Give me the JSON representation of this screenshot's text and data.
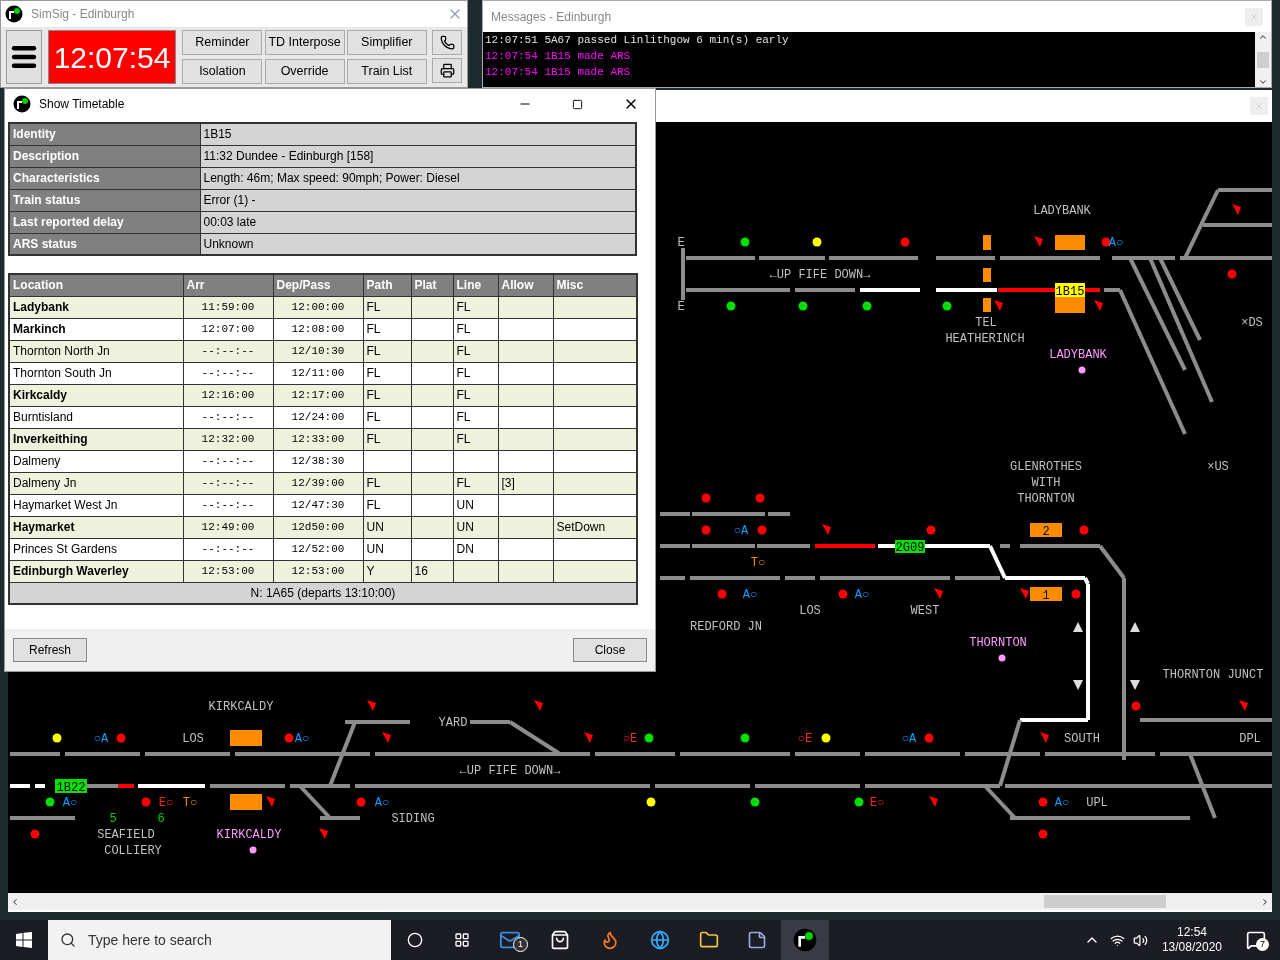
{
  "main_window": {
    "title": "SimSig - Edinburgh",
    "clock": "12:07:54",
    "buttons": [
      "Reminder",
      "TD Interpose",
      "Simplifier",
      "Isolation",
      "Override",
      "Train List"
    ]
  },
  "messages_window": {
    "title": "Messages - Edinburgh",
    "lines": [
      {
        "text": "12:07:51 5A67 passed Linlithgow 6 min(s) early",
        "kind": "event"
      },
      {
        "text": "12:07:54 1B15 made ARS",
        "kind": "ars"
      },
      {
        "text": "12:07:54 1B15 made ARS",
        "kind": "ars"
      }
    ]
  },
  "timetable_window": {
    "title": "Show Timetable",
    "details": [
      {
        "label": "Identity",
        "value": "1B15"
      },
      {
        "label": "Description",
        "value": "11:32 Dundee - Edinburgh [158]"
      },
      {
        "label": "Characteristics",
        "value": "Length: 46m; Max speed: 90mph; Power: Diesel"
      },
      {
        "label": "Train status",
        "value": "Error (1) -"
      },
      {
        "label": "Last reported delay",
        "value": "00:03 late"
      },
      {
        "label": "ARS status",
        "value": "Unknown"
      }
    ],
    "columns": [
      "Location",
      "Arr",
      "Dep/Pass",
      "Path",
      "Plat",
      "Line",
      "Allow",
      "Misc"
    ],
    "rows": [
      {
        "kind": "stop",
        "location": "Ladybank",
        "arr": "11:59:00",
        "dep": "12:00:00",
        "path": "FL",
        "line": "FL"
      },
      {
        "kind": "stop",
        "location": "Markinch",
        "arr": "12:07:00",
        "dep": "12:08:00",
        "path": "FL",
        "line": "FL"
      },
      {
        "kind": "pass",
        "location": "Thornton North Jn",
        "arr": "--:--:--",
        "dep": "12/10:30",
        "path": "FL",
        "line": "FL"
      },
      {
        "kind": "pass",
        "location": "Thornton South Jn",
        "arr": "--:--:--",
        "dep": "12/11:00",
        "path": "FL",
        "line": "FL"
      },
      {
        "kind": "stop",
        "location": "Kirkcaldy",
        "arr": "12:16:00",
        "dep": "12:17:00",
        "path": "FL",
        "line": "FL"
      },
      {
        "kind": "pass",
        "location": "Burntisland",
        "arr": "--:--:--",
        "dep": "12/24:00",
        "path": "FL",
        "line": "FL"
      },
      {
        "kind": "stop",
        "location": "Inverkeithing",
        "arr": "12:32:00",
        "dep": "12:33:00",
        "path": "FL",
        "line": "FL"
      },
      {
        "kind": "pass",
        "location": "Dalmeny",
        "arr": "--:--:--",
        "dep": "12/38:30"
      },
      {
        "kind": "pass",
        "location": "Dalmeny Jn",
        "arr": "--:--:--",
        "dep": "12/39:00",
        "path": "FL",
        "line": "FL",
        "allow": "[3]"
      },
      {
        "kind": "pass",
        "location": "Haymarket West Jn",
        "arr": "--:--:--",
        "dep": "12/47:30",
        "path": "FL",
        "line": "UN"
      },
      {
        "kind": "stop",
        "location": "Haymarket",
        "arr": "12:49:00",
        "dep": "12d50:00",
        "path": "UN",
        "line": "UN",
        "misc": "SetDown"
      },
      {
        "kind": "pass",
        "location": "Princes St Gardens",
        "arr": "--:--:--",
        "dep": "12/52:00",
        "path": "UN",
        "line": "DN"
      },
      {
        "kind": "stop",
        "location": "Edinburgh Waverley",
        "arr": "12:53:00",
        "dep": "12:53:00",
        "path": "Y",
        "plat": "16"
      }
    ],
    "footer": "N: 1A65 (departs 13:10:00)",
    "buttons": [
      "Refresh",
      "Close"
    ]
  },
  "diagram": {
    "labels": [
      {
        "text": "E",
        "kind": "area"
      },
      {
        "text": "E",
        "kind": "area"
      },
      {
        "text": "LADYBANK",
        "kind": "area"
      },
      {
        "text": "←UP FIFE DOWN→",
        "kind": "area"
      },
      {
        "text": "TEL",
        "kind": "area"
      },
      {
        "text": "HEATHERINCH",
        "kind": "area"
      },
      {
        "text": "LADYBANK",
        "kind": "station"
      },
      {
        "text": "×DS",
        "kind": "area"
      },
      {
        "text": "×US",
        "kind": "area"
      },
      {
        "text": "GLENROTHES",
        "kind": "area"
      },
      {
        "text": "WITH",
        "kind": "area"
      },
      {
        "text": "THORNTON",
        "kind": "area"
      },
      {
        "text": "LOS",
        "kind": "area"
      },
      {
        "text": "WEST",
        "kind": "area"
      },
      {
        "text": "REDFORD JN",
        "kind": "area"
      },
      {
        "text": "THORNTON",
        "kind": "station"
      },
      {
        "text": "THORNTON JUNCT",
        "kind": "area"
      },
      {
        "text": "KIRKCALDY",
        "kind": "area"
      },
      {
        "text": "YARD",
        "kind": "area"
      },
      {
        "text": "LOS",
        "kind": "area"
      },
      {
        "text": "←UP FIFE DOWN→",
        "kind": "area"
      },
      {
        "text": "SOUTH",
        "kind": "area"
      },
      {
        "text": "DPL",
        "kind": "area"
      },
      {
        "text": "UPL",
        "kind": "area"
      },
      {
        "text": "SIDING",
        "kind": "area"
      },
      {
        "text": "SEAFIELD",
        "kind": "area"
      },
      {
        "text": "COLLIERY",
        "kind": "area"
      },
      {
        "text": "KIRKCALDY",
        "kind": "station"
      },
      {
        "text": "A○",
        "kind": "ars"
      },
      {
        "text": "○A",
        "kind": "ars"
      },
      {
        "text": "T○",
        "kind": "trts"
      },
      {
        "text": "A○",
        "kind": "ars"
      },
      {
        "text": "A○",
        "kind": "ars"
      },
      {
        "text": "○A",
        "kind": "ars"
      },
      {
        "text": "A○",
        "kind": "ars"
      },
      {
        "text": "A○",
        "kind": "ars"
      },
      {
        "text": "E○",
        "kind": "ext"
      },
      {
        "text": "T○",
        "kind": "trts"
      },
      {
        "text": "A○",
        "kind": "ars"
      },
      {
        "text": "○E",
        "kind": "ext"
      },
      {
        "text": "○E",
        "kind": "ext"
      },
      {
        "text": "○A",
        "kind": "ars"
      },
      {
        "text": "E○",
        "kind": "ext"
      },
      {
        "text": "A○",
        "kind": "ars"
      },
      {
        "text": "5",
        "kind": "count"
      },
      {
        "text": "6",
        "kind": "count"
      }
    ],
    "berths": [
      {
        "text": "1B15",
        "color": "#ffff00"
      },
      {
        "text": "2G09",
        "color": "#00e000"
      },
      {
        "text": "2",
        "color": "#ff8c00"
      },
      {
        "text": "1",
        "color": "#ff8c00"
      },
      {
        "text": "1B22",
        "color": "#00e000"
      }
    ],
    "signals": [
      {
        "color": "#00e000"
      },
      {
        "color": "#ffff00"
      },
      {
        "color": "#ff0000"
      },
      {
        "color": "#ff0000"
      },
      {
        "color": "#00e000"
      },
      {
        "color": "#00e000"
      },
      {
        "color": "#00e000"
      },
      {
        "color": "#00e000"
      },
      {
        "color": "#ff0000"
      },
      {
        "color": "#ff0000"
      },
      {
        "color": "#ff0000"
      },
      {
        "color": "#ff0000"
      },
      {
        "color": "#ff0000"
      },
      {
        "color": "#ff0000"
      },
      {
        "color": "#ff0000"
      },
      {
        "color": "#ff0000"
      },
      {
        "color": "#ff0000"
      },
      {
        "color": "#ffff00"
      },
      {
        "color": "#ff0000"
      },
      {
        "color": "#ff0000"
      },
      {
        "color": "#00e000"
      },
      {
        "color": "#00e000"
      },
      {
        "color": "#ffff00"
      },
      {
        "color": "#ff0000"
      },
      {
        "color": "#ff0000"
      },
      {
        "color": "#00e000"
      },
      {
        "color": "#ff0000"
      },
      {
        "color": "#ff0000"
      },
      {
        "color": "#ffff00"
      },
      {
        "color": "#00e000"
      },
      {
        "color": "#00e000"
      },
      {
        "color": "#ff0000"
      },
      {
        "color": "#ff0000"
      },
      {
        "color": "#ff0000"
      },
      {
        "color": "#ff0000"
      }
    ]
  },
  "taskbar": {
    "search_placeholder": "Type here to search",
    "mail_badge": "1",
    "time": "12:54",
    "date": "13/08/2020",
    "notification_badge": "7"
  }
}
